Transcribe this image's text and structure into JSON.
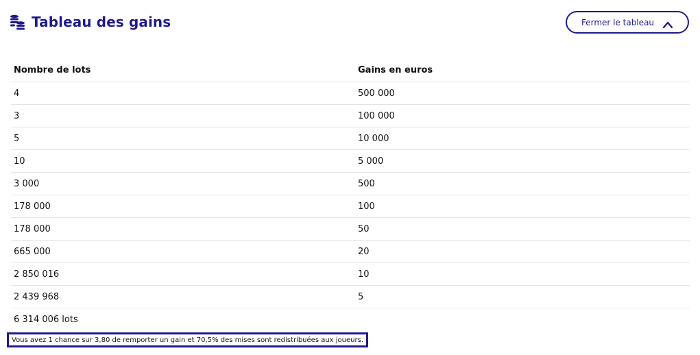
{
  "header": {
    "title": "Tableau des gains",
    "title_icon": "coins-icon",
    "close_label": "Fermer le tableau",
    "close_icon": "chevron-up-icon"
  },
  "table": {
    "columns": [
      "Nombre de lots",
      "Gains en euros"
    ],
    "rows": [
      {
        "lots": "4",
        "gains": "500 000"
      },
      {
        "lots": "3",
        "gains": "100 000"
      },
      {
        "lots": "5",
        "gains": "10 000"
      },
      {
        "lots": "10",
        "gains": "5 000"
      },
      {
        "lots": "3 000",
        "gains": "500"
      },
      {
        "lots": "178 000",
        "gains": "100"
      },
      {
        "lots": "178 000",
        "gains": "50"
      },
      {
        "lots": "665 000",
        "gains": "20"
      },
      {
        "lots": "2 850 016",
        "gains": "10"
      },
      {
        "lots": "2 439 968",
        "gains": "5"
      }
    ],
    "total": "6 314 006 lots"
  },
  "note": "Vous avez 1 chance sur 3,80 de remporter un gain et 70,5% des mises sont redistribuées aux joueurs.",
  "colors": {
    "brand": "#1f1b86",
    "divider": "#e3e3e3"
  }
}
